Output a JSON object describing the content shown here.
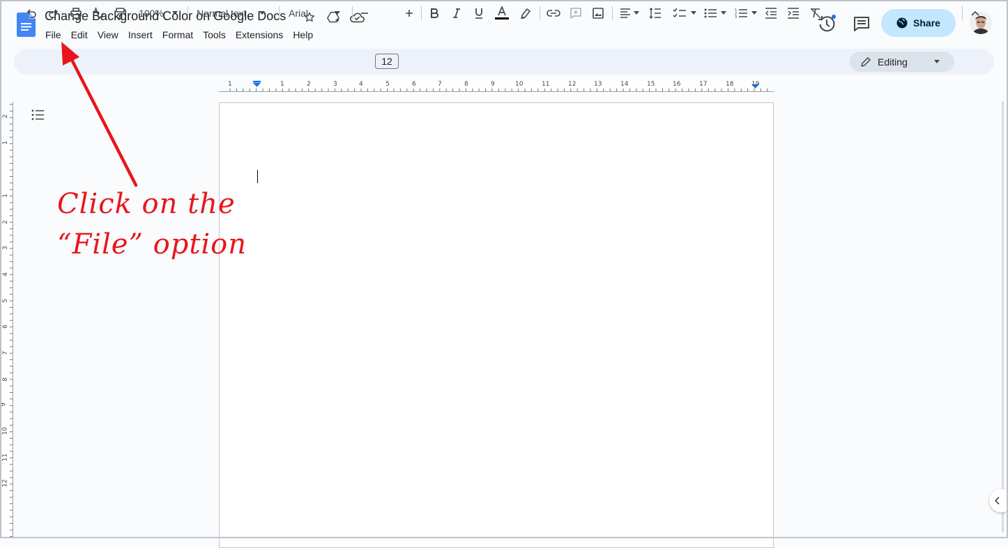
{
  "document": {
    "title": "Change Background Color on Google Docs"
  },
  "menu": {
    "items": [
      "File",
      "Edit",
      "View",
      "Insert",
      "Format",
      "Tools",
      "Extensions",
      "Help"
    ]
  },
  "header": {
    "share_label": "Share"
  },
  "toolbar": {
    "zoom": "100%",
    "style": "Normal text",
    "font": "Arial",
    "font_size": "12",
    "mode": "Editing"
  },
  "ruler": {
    "horizontal": [
      "1",
      "1",
      "2",
      "3",
      "4",
      "5",
      "6",
      "7",
      "8",
      "9",
      "10",
      "11",
      "12",
      "13",
      "14",
      "15",
      "16",
      "17",
      "18",
      "19"
    ],
    "vertical": [
      "2",
      "1",
      "1",
      "2",
      "3",
      "4",
      "5",
      "6",
      "7",
      "8",
      "9",
      "10",
      "11",
      "12"
    ]
  },
  "annotation": {
    "line1": "Click on the",
    "line2": "“File” option",
    "color": "#e8161b"
  },
  "colors": {
    "share_bg": "#c2e7ff",
    "toolbar_bg": "#edf2fa",
    "docs_blue": "#4285f4"
  },
  "icons": {
    "title": [
      "star-icon",
      "move-to-drive-icon",
      "cloud-saved-icon"
    ],
    "toolbar": [
      "undo-icon",
      "redo-icon",
      "print-icon",
      "spellcheck-icon",
      "paint-format-icon",
      "bold-icon",
      "italic-icon",
      "underline-icon",
      "text-color-icon",
      "highlight-icon",
      "link-icon",
      "add-comment-icon",
      "insert-image-icon",
      "align-icon",
      "line-spacing-icon",
      "checklist-icon",
      "bulleted-list-icon",
      "numbered-list-icon",
      "decrease-indent-icon",
      "increase-indent-icon",
      "clear-formatting-icon",
      "pencil-icon",
      "collapse-toolbar-icon"
    ]
  }
}
